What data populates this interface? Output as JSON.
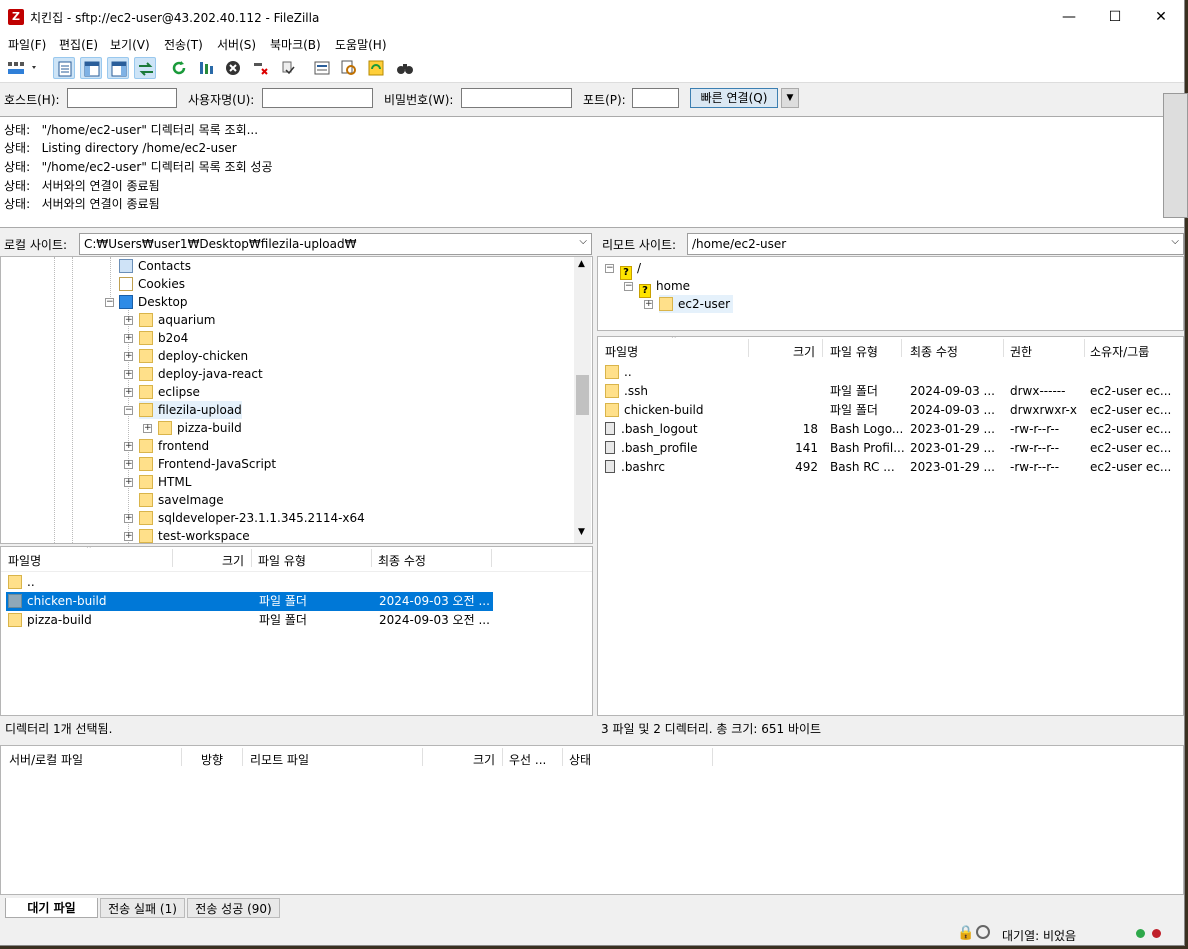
{
  "window": {
    "title": "치킨집 - sftp://ec2-user@43.202.40.112 - FileZilla",
    "minimize": "—",
    "maximize": "☐",
    "close": "✕"
  },
  "menu": [
    "파일(F)",
    "편집(E)",
    "보기(V)",
    "전송(T)",
    "서버(S)",
    "북마크(B)",
    "도움말(H)"
  ],
  "quickconnect": {
    "host_label": "호스트(H):",
    "host_value": "",
    "user_label": "사용자명(U):",
    "user_value": "",
    "pass_label": "비밀번호(W):",
    "pass_value": "",
    "port_label": "포트(P):",
    "port_value": "",
    "button": "빠른 연결(Q)",
    "dropdown": "▼"
  },
  "log": [
    {
      "label": "상태:",
      "text": "\"/home/ec2-user\" 디렉터리 목록 조회..."
    },
    {
      "label": "상태:",
      "text": "Listing directory /home/ec2-user"
    },
    {
      "label": "상태:",
      "text": "\"/home/ec2-user\" 디렉터리 목록 조회 성공"
    },
    {
      "label": "상태:",
      "text": "서버와의 연결이 종료됨"
    },
    {
      "label": "상태:",
      "text": "서버와의 연결이 종료됨"
    }
  ],
  "local": {
    "site_label": "로컬 사이트:",
    "site_path": "C:₩Users₩user1₩Desktop₩filezila-upload₩",
    "tree": [
      {
        "label": "Contacts",
        "icon": "contact"
      },
      {
        "label": "Cookies",
        "icon": "white"
      },
      {
        "label": "Desktop",
        "icon": "blue"
      },
      {
        "label": "aquarium",
        "icon": "folder"
      },
      {
        "label": "b2o4",
        "icon": "folder"
      },
      {
        "label": "deploy-chicken",
        "icon": "folder"
      },
      {
        "label": "deploy-java-react",
        "icon": "folder"
      },
      {
        "label": "eclipse",
        "icon": "folder"
      },
      {
        "label": "filezila-upload",
        "icon": "folder"
      },
      {
        "label": "pizza-build",
        "icon": "folder"
      },
      {
        "label": "frontend",
        "icon": "folder"
      },
      {
        "label": "Frontend-JavaScript",
        "icon": "folder"
      },
      {
        "label": "HTML",
        "icon": "folder"
      },
      {
        "label": "saveImage",
        "icon": "folder"
      },
      {
        "label": "sqldeveloper-23.1.1.345.2114-x64",
        "icon": "folder"
      },
      {
        "label": "test-workspace",
        "icon": "folder"
      }
    ],
    "columns": [
      "파일명",
      "크기",
      "파일 유형",
      "최종 수정"
    ],
    "files": [
      {
        "name": "..",
        "size": "",
        "type": "",
        "modified": ""
      },
      {
        "name": "chicken-build",
        "size": "",
        "type": "파일 폴더",
        "modified": "2024-09-03 오전 ..."
      },
      {
        "name": "pizza-build",
        "size": "",
        "type": "파일 폴더",
        "modified": "2024-09-03 오전 ..."
      }
    ],
    "status": "디렉터리 1개 선택됨."
  },
  "remote": {
    "site_label": "리모트 사이트:",
    "site_path": "/home/ec2-user",
    "tree": [
      {
        "label": "/"
      },
      {
        "label": "home"
      },
      {
        "label": "ec2-user"
      }
    ],
    "columns": [
      "파일명",
      "크기",
      "파일 유형",
      "최종 수정",
      "권한",
      "소유자/그룹"
    ],
    "files": [
      {
        "name": "..",
        "size": "",
        "type": "",
        "modified": "",
        "perm": "",
        "owner": "",
        "icon": "folder"
      },
      {
        "name": ".ssh",
        "size": "",
        "type": "파일 폴더",
        "modified": "2024-09-03 ...",
        "perm": "drwx------",
        "owner": "ec2-user ec...",
        "icon": "folder"
      },
      {
        "name": "chicken-build",
        "size": "",
        "type": "파일 폴더",
        "modified": "2024-09-03 ...",
        "perm": "drwxrwxr-x",
        "owner": "ec2-user ec...",
        "icon": "folder"
      },
      {
        "name": ".bash_logout",
        "size": "18",
        "type": "Bash Logo...",
        "modified": "2023-01-29 ...",
        "perm": "-rw-r--r--",
        "owner": "ec2-user ec...",
        "icon": "file"
      },
      {
        "name": ".bash_profile",
        "size": "141",
        "type": "Bash Profil...",
        "modified": "2023-01-29 ...",
        "perm": "-rw-r--r--",
        "owner": "ec2-user ec...",
        "icon": "file"
      },
      {
        "name": ".bashrc",
        "size": "492",
        "type": "Bash RC ...",
        "modified": "2023-01-29 ...",
        "perm": "-rw-r--r--",
        "owner": "ec2-user ec...",
        "icon": "file"
      }
    ],
    "status": "3 파일 및 2 디렉터리. 총 크기: 651 바이트"
  },
  "queue": {
    "columns": [
      "서버/로컬 파일",
      "방향",
      "리모트 파일",
      "크기",
      "우선 ...",
      "상태"
    ],
    "tabs": [
      "대기 파일",
      "전송 실패 (1)",
      "전송 성공 (90)"
    ]
  },
  "statusbar": {
    "queue_text": "대기열: 비었음"
  },
  "colors": {
    "selection": "#0078d7",
    "connect_button": "#dbe8f3"
  }
}
